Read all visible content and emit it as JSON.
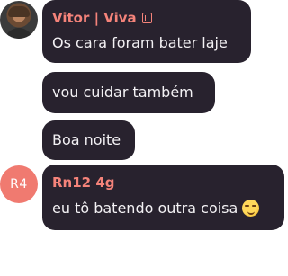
{
  "messages": [
    {
      "sender": "Vitor | Viva",
      "badge_icon": "book-icon",
      "text": "Os cara foram bater laje",
      "avatar": "photo"
    },
    {
      "text": "vou cuidar também"
    },
    {
      "text": "Boa noite"
    },
    {
      "sender": "Rn12 4g",
      "text": "eu tô batendo outra coisa",
      "emoji": "smirking-face-emoji",
      "avatar_initials": "R4"
    }
  ],
  "colors": {
    "bubble_bg": "#28222e",
    "sender_name": "#f5837a",
    "message_text": "#f3f1f4",
    "initials_avatar_bg": "#f07a70"
  }
}
